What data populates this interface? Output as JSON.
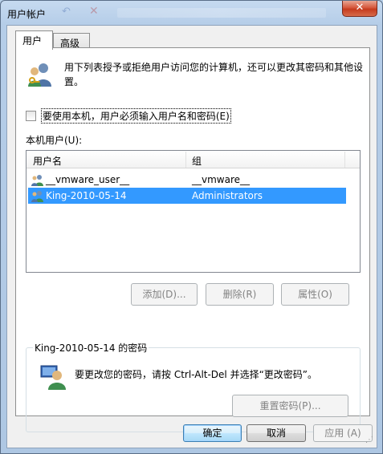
{
  "window": {
    "title": "用户帐户",
    "close_label": "✕"
  },
  "tabs": [
    {
      "label": "用户",
      "active": true
    },
    {
      "label": "高级",
      "active": false
    }
  ],
  "intro": {
    "text": "用下列表授予或拒绝用户访问您的计算机，还可以更改其密码和其他设置。"
  },
  "require_login": {
    "label": "要使用本机，用户必须输入用户名和密码(E)",
    "checked": false
  },
  "users_section": {
    "label": "本机用户(U):",
    "columns": [
      "用户名",
      "组"
    ],
    "rows": [
      {
        "name": "__vmware_user__",
        "group": "__vmware__",
        "selected": false
      },
      {
        "name": "King-2010-05-14",
        "group": "Administrators",
        "selected": true
      }
    ]
  },
  "user_buttons": {
    "add": "添加(D)...",
    "delete": "删除(R)",
    "properties": "属性(O)"
  },
  "password_group": {
    "title": "King-2010-05-14 的密码",
    "text": "要更改您的密码，请按 Ctrl-Alt-Del 并选择“更改密码”。",
    "reset_button": "重置密码(P)..."
  },
  "footer": {
    "ok": "确定",
    "cancel": "取消",
    "apply": "应用 (A)"
  },
  "colors": {
    "selection": "#3399ff",
    "close_button": "#c53b1e"
  }
}
